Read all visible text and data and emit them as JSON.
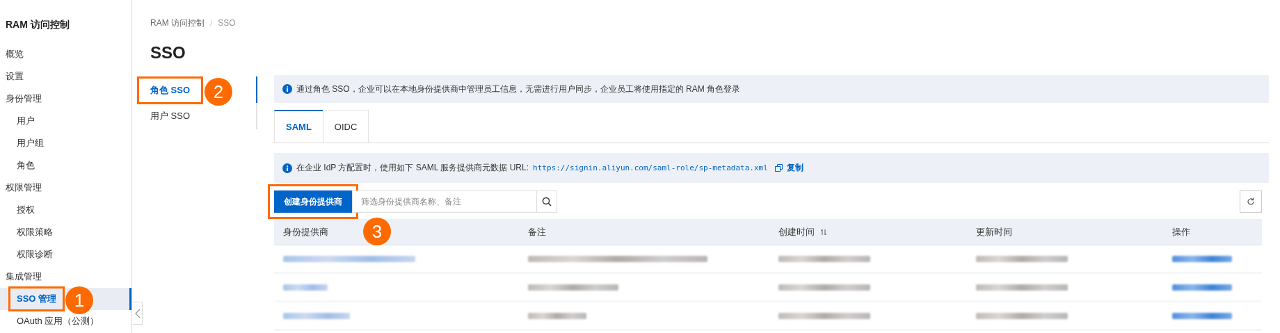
{
  "sidebar": {
    "title": "RAM 访问控制",
    "items": [
      {
        "label": "概览",
        "selected": false
      },
      {
        "label": "设置",
        "selected": false
      },
      {
        "label": "身份管理",
        "selected": false,
        "children": [
          {
            "label": "用户",
            "selected": false
          },
          {
            "label": "用户组",
            "selected": false
          },
          {
            "label": "角色",
            "selected": false
          }
        ]
      },
      {
        "label": "权限管理",
        "selected": false,
        "children": [
          {
            "label": "授权",
            "selected": false
          },
          {
            "label": "权限策略",
            "selected": false
          },
          {
            "label": "权限诊断",
            "selected": false
          }
        ]
      },
      {
        "label": "集成管理",
        "selected": false,
        "children": [
          {
            "label": "SSO 管理",
            "selected": true,
            "callout": "1"
          },
          {
            "label": "OAuth 应用（公测）",
            "selected": false
          }
        ]
      }
    ]
  },
  "breadcrumb": [
    "RAM 访问控制",
    "SSO"
  ],
  "breadcrumb_separator": "/",
  "page_title": "SSO",
  "subnav": [
    {
      "label": "角色 SSO",
      "selected": true,
      "callout": "2"
    },
    {
      "label": "用户 SSO",
      "selected": false
    }
  ],
  "notice": "通过角色 SSO，企业可以在本地身份提供商中管理员工信息，无需进行用户同步，企业员工将使用指定的 RAM 角色登录",
  "tabs": [
    {
      "label": "SAML",
      "selected": true
    },
    {
      "label": "OIDC",
      "selected": false
    }
  ],
  "metadata_notice": {
    "text": "在企业 IdP 方配置时，使用如下 SAML 服务提供商元数据 URL:",
    "url": "https://signin.aliyun.com/saml-role/sp-metadata.xml",
    "copy": "复制"
  },
  "toolbar": {
    "create_button": "创建身份提供商",
    "create_callout": "3",
    "search": {
      "placeholder": "筛选身份提供商名称、备注"
    }
  },
  "table": {
    "columns": [
      {
        "label": "身份提供商",
        "sortable": false
      },
      {
        "label": "备注",
        "sortable": false
      },
      {
        "label": "创建时间",
        "sortable": true
      },
      {
        "label": "更新时间",
        "sortable": false
      },
      {
        "label": "操作",
        "sortable": false
      }
    ],
    "rows": [
      {
        "cells": [
          {
            "kind": "link"
          },
          {
            "kind": "text"
          },
          {
            "kind": "text"
          },
          {
            "kind": "text"
          },
          {
            "kind": "link"
          }
        ]
      },
      {
        "cells": [
          {
            "kind": "link"
          },
          {
            "kind": "text"
          },
          {
            "kind": "text"
          },
          {
            "kind": "text"
          },
          {
            "kind": "link"
          }
        ]
      },
      {
        "cells": [
          {
            "kind": "link"
          },
          {
            "kind": "text"
          },
          {
            "kind": "text"
          },
          {
            "kind": "text"
          },
          {
            "kind": "link"
          }
        ]
      }
    ]
  }
}
